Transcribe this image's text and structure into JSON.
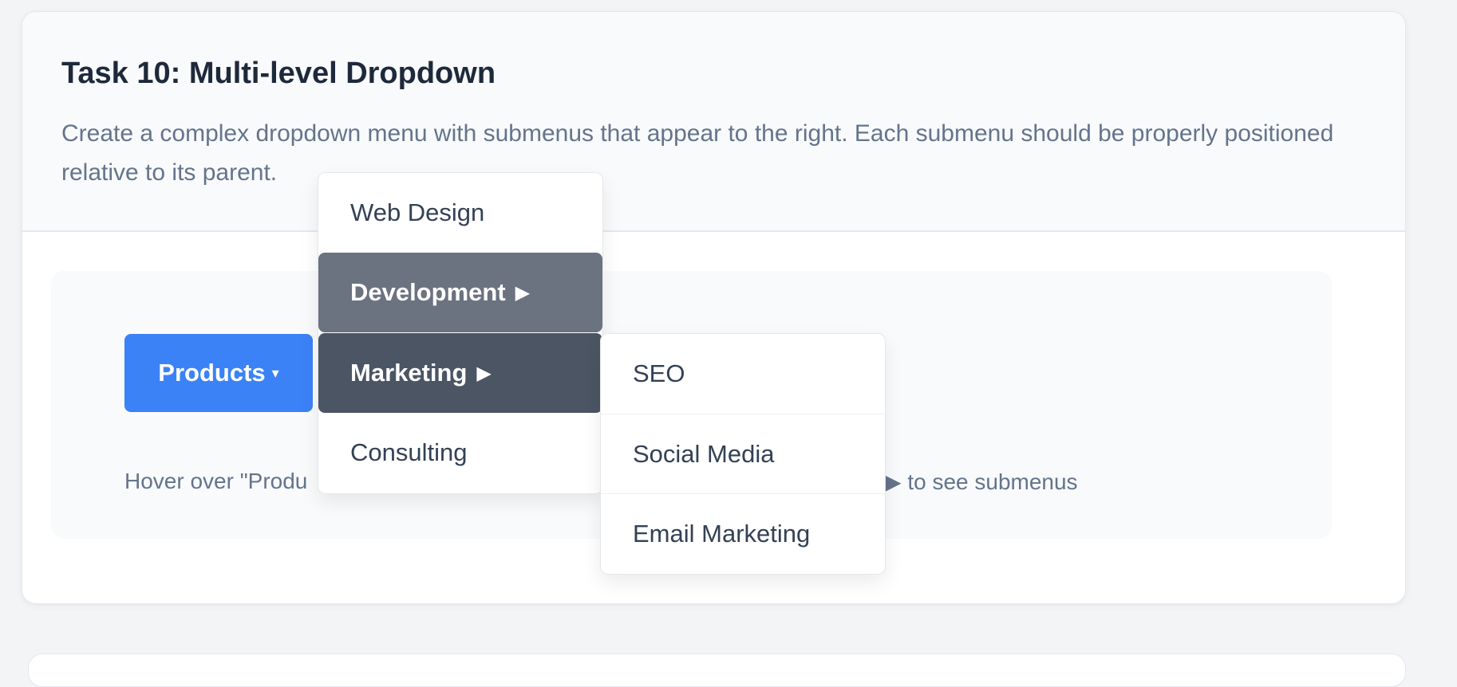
{
  "task": {
    "title": "Task 10: Multi-level Dropdown",
    "description": "Create a complex dropdown menu with submenus that appear to the right. Each submenu should be properly positioned relative to its parent."
  },
  "products_button": {
    "label": "Products",
    "caret": "▾"
  },
  "menu": {
    "items": [
      {
        "label": "Web Design",
        "arrow": ""
      },
      {
        "label": "Development",
        "arrow": "▶"
      },
      {
        "label": "Marketing",
        "arrow": "▶"
      },
      {
        "label": "Consulting",
        "arrow": ""
      }
    ]
  },
  "submenu": {
    "items": [
      {
        "label": "SEO"
      },
      {
        "label": "Social Media"
      },
      {
        "label": "Email Marketing"
      }
    ]
  },
  "hint": {
    "start": "Hover over \"Produ",
    "end": "▶ to see submenus"
  },
  "colors": {
    "accent": "#3b82f6",
    "hover_item": "#6b7280",
    "active_item": "#4b5563"
  }
}
